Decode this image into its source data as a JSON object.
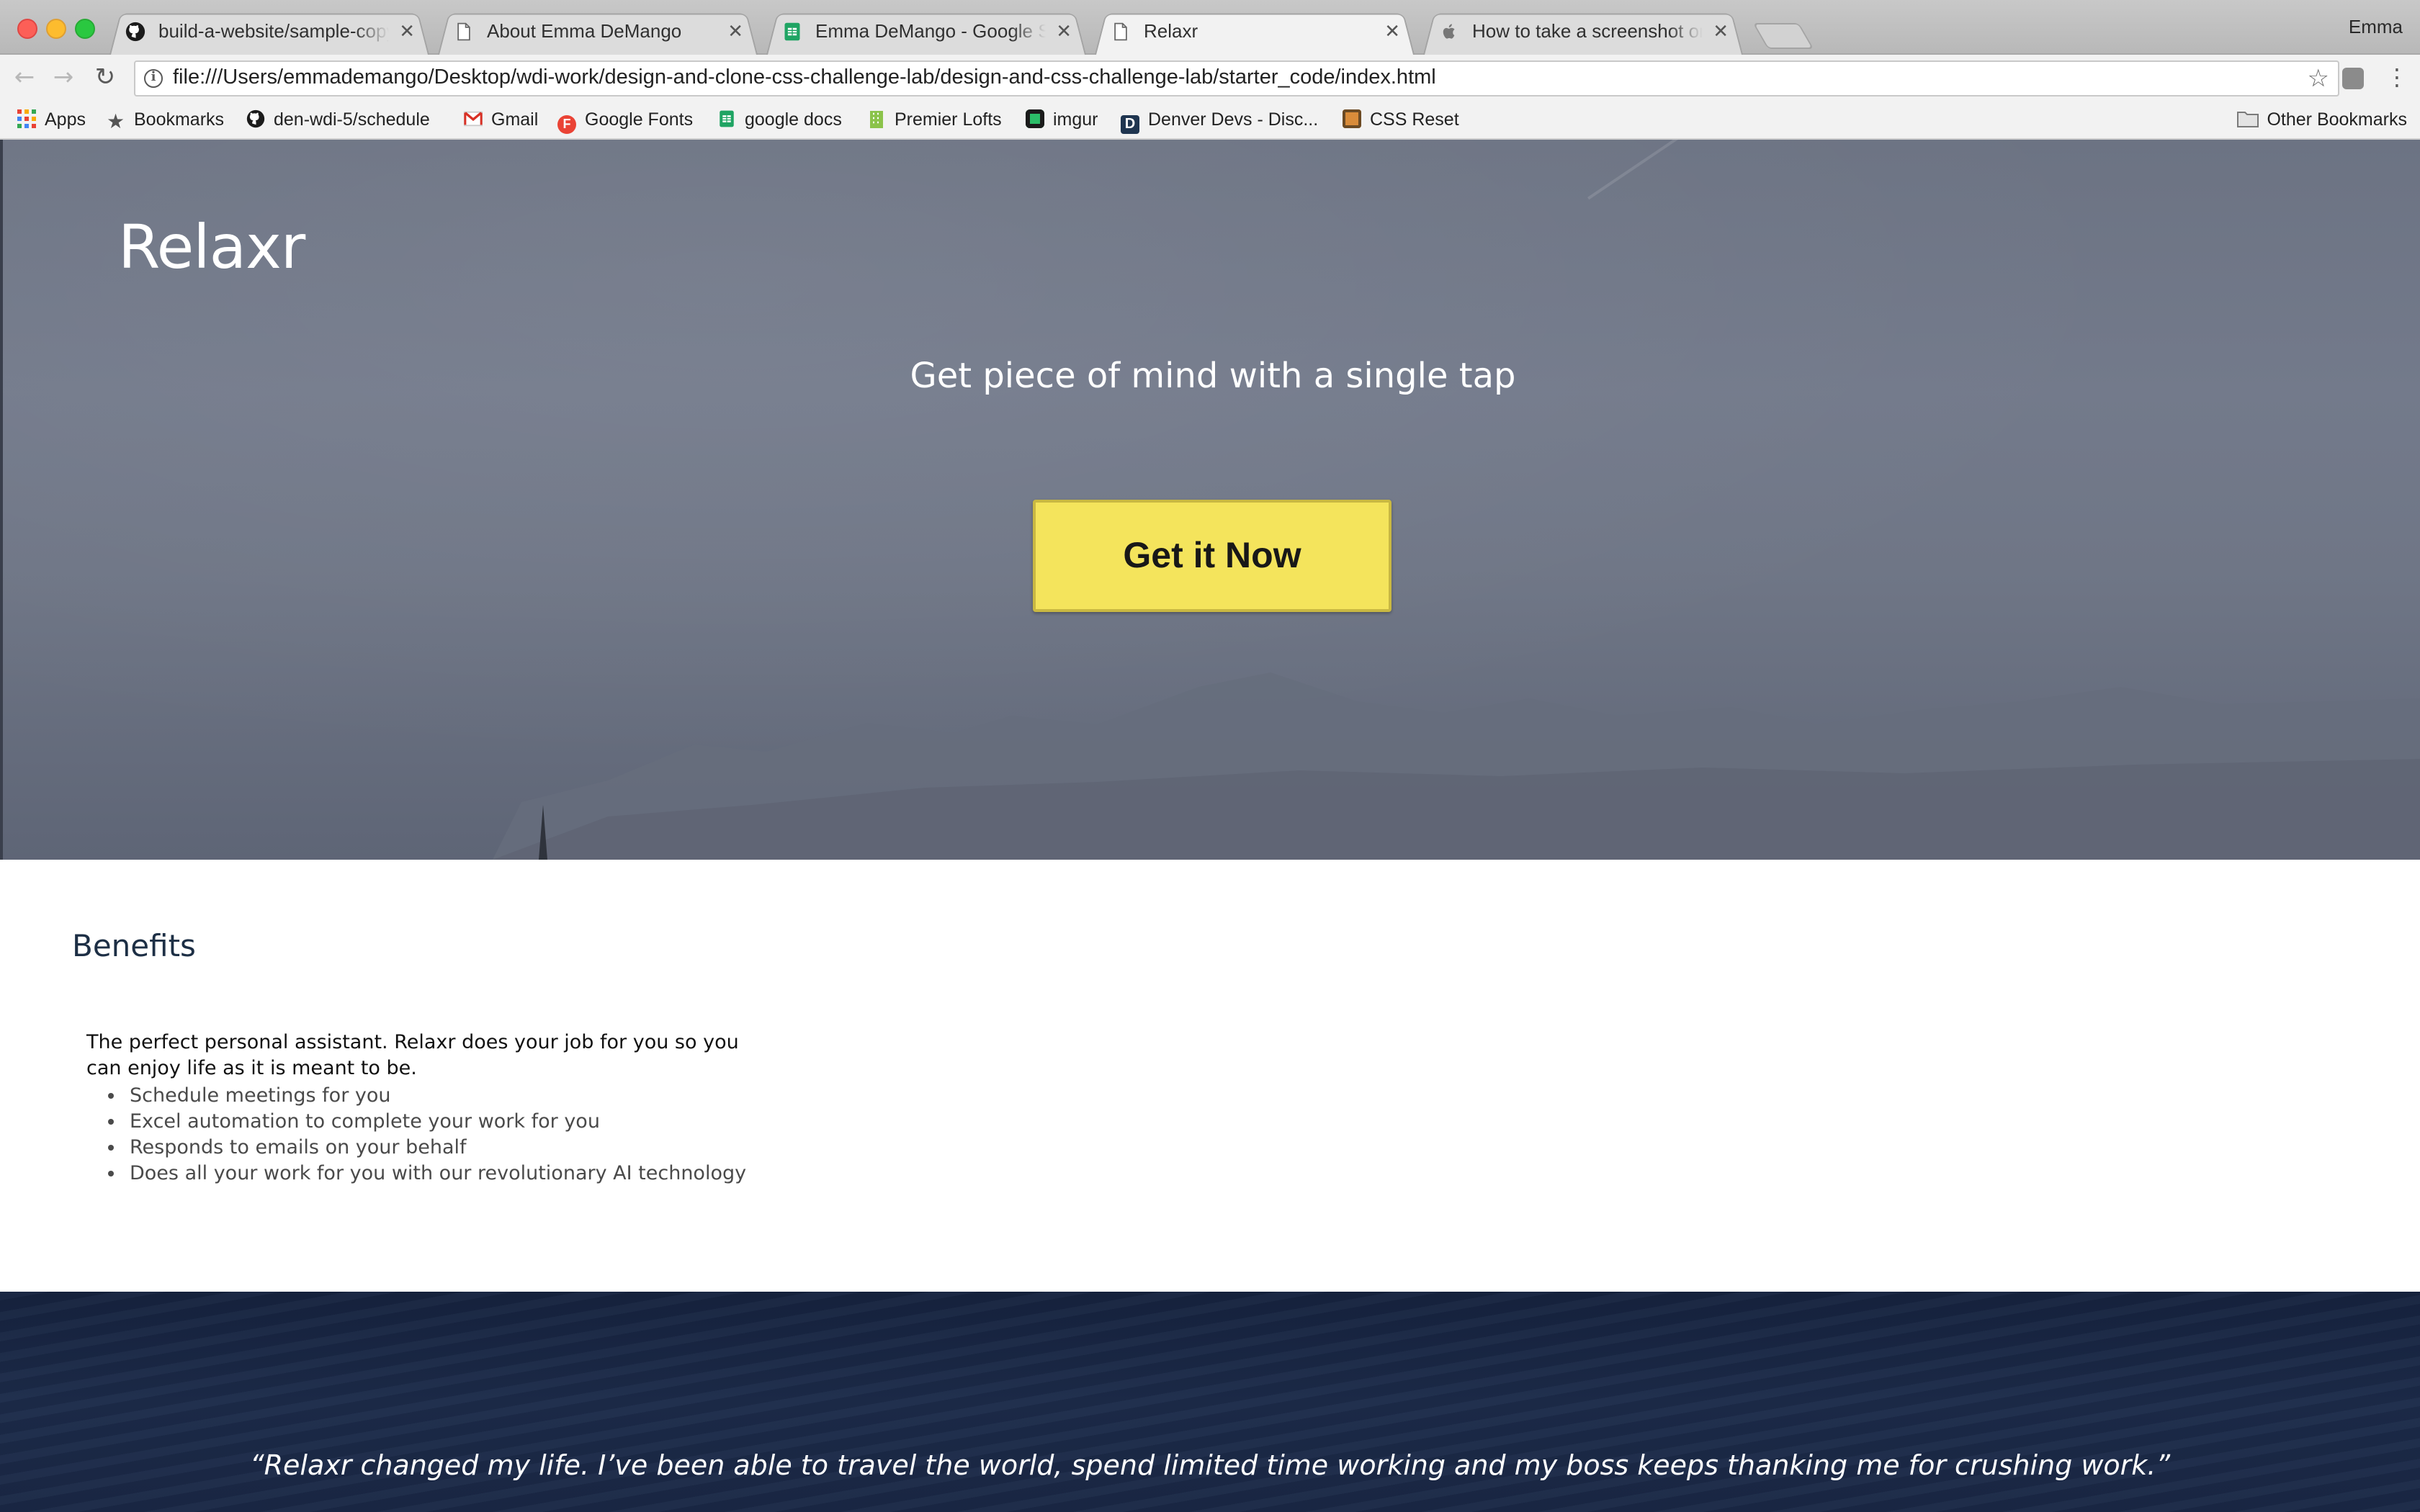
{
  "browser": {
    "tabs": [
      {
        "title": "build-a-website/sample-copy.txt",
        "icon": "github-icon",
        "active": false
      },
      {
        "title": "About Emma DeMango",
        "icon": "page-icon",
        "active": false
      },
      {
        "title": "Emma DeMango - Google Sheets",
        "icon": "google-sheets-icon",
        "active": false
      },
      {
        "title": "Relaxr",
        "icon": "page-icon",
        "active": true
      },
      {
        "title": "How to take a screenshot on your Mac",
        "icon": "apple-icon",
        "active": false
      }
    ],
    "profile_name": "Emma",
    "url": "file:///Users/emmademango/Desktop/wdi-work/design-and-clone-css-challenge-lab/design-and-css-challenge-lab/starter_code/index.html",
    "bookmarks": [
      {
        "label": "Apps",
        "icon": "apps-grid-icon"
      },
      {
        "label": "Bookmarks",
        "icon": "star-icon"
      },
      {
        "label": "den-wdi-5/schedule",
        "icon": "github-icon"
      },
      {
        "label": "Gmail",
        "icon": "gmail-icon"
      },
      {
        "label": "Google Fonts",
        "icon": "google-fonts-icon"
      },
      {
        "label": "google docs",
        "icon": "google-sheets-icon"
      },
      {
        "label": "Premier Lofts",
        "icon": "building-icon"
      },
      {
        "label": "imgur",
        "icon": "imgur-icon"
      },
      {
        "label": "Denver Devs - Disc...",
        "icon": "denver-devs-icon"
      },
      {
        "label": "CSS Reset",
        "icon": "css-reset-icon"
      }
    ],
    "other_bookmarks": "Other Bookmarks"
  },
  "hero": {
    "brand": "Relaxr",
    "tagline": "Get piece of mind with a single tap",
    "cta_label": "Get it Now"
  },
  "benefits": {
    "heading": "Benefits",
    "description": "The perfect personal assistant. Relaxr does your job for you so you can enjoy life as it is meant to be.",
    "items": [
      "Schedule meetings for you",
      "Excel automation to complete your work for you",
      "Responds to emails on your behalf",
      "Does all your work for you with our revolutionary AI technology"
    ]
  },
  "testimonial": {
    "quote": "“Relaxr changed my life. I’ve been able to travel the world, spend limited time working and my boss keeps thanking me for crushing work.”"
  },
  "colors": {
    "cta_background": "#f4e45c",
    "benefits_heading": "#1d2f45",
    "testimonial_background": "#1c2b4a"
  }
}
